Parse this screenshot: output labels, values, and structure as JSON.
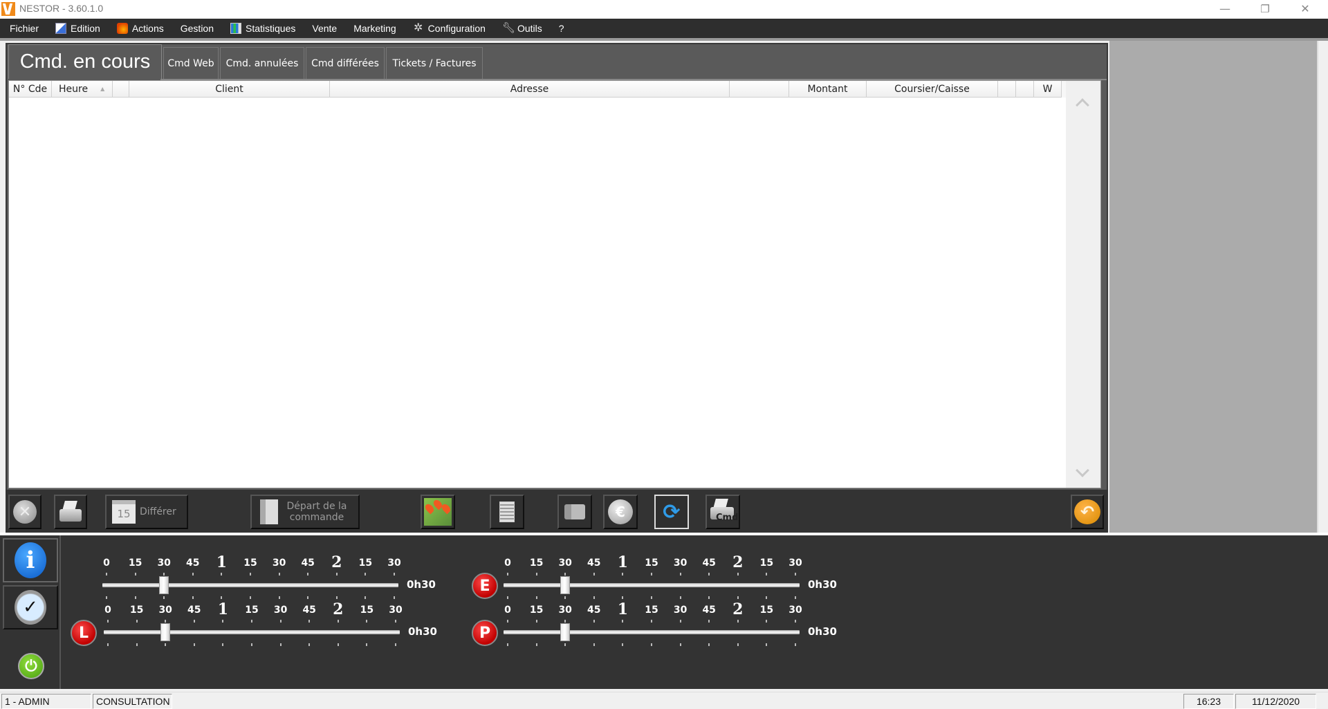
{
  "window": {
    "title": "NESTOR - 3.60.1.0",
    "minimize": "—",
    "maximize": "❐",
    "close": "✕"
  },
  "menu": [
    {
      "label": "Fichier",
      "icon": null
    },
    {
      "label": "Edition",
      "icon": "edit-icon"
    },
    {
      "label": "Actions",
      "icon": "actions-icon"
    },
    {
      "label": "Gestion",
      "icon": null
    },
    {
      "label": "Statistiques",
      "icon": "chart-icon"
    },
    {
      "label": "Vente",
      "icon": null
    },
    {
      "label": "Marketing",
      "icon": null
    },
    {
      "label": "Configuration",
      "icon": "gear-icon"
    },
    {
      "label": "Outils",
      "icon": "wrench-icon"
    },
    {
      "label": "?",
      "icon": null
    }
  ],
  "tabs": [
    {
      "label": "Cmd. en cours",
      "active": true
    },
    {
      "label": "Cmd Web",
      "active": false
    },
    {
      "label": "Cmd. annulées",
      "active": false
    },
    {
      "label": "Cmd différées",
      "active": false
    },
    {
      "label": "Tickets / Factures",
      "active": false
    }
  ],
  "table": {
    "columns": [
      "N° Cde",
      "Heure",
      "",
      "Client",
      "Adresse",
      "",
      "Montant",
      "Coursier/Caisse",
      "",
      "",
      "W"
    ],
    "sort_column": "Heure",
    "sort_direction": "ascending",
    "rows": []
  },
  "toolbar": {
    "cancel": "Annuler",
    "print": "Imprimer",
    "defer_label": "Différer",
    "defer_icon_text": "15",
    "depart_label": "Départ de la commande",
    "map": "Carte",
    "document": "Document",
    "card": "Fiche",
    "payment": "Paiement",
    "refresh": "Actualiser",
    "print_cmd_text": "Cmd",
    "back": "Retour"
  },
  "timelines": {
    "tick_labels": [
      "0",
      "15",
      "30",
      "45",
      "1",
      "15",
      "30",
      "45",
      "2",
      "15",
      "30"
    ],
    "big_ticks": [
      4,
      8
    ],
    "range_minutes": [
      0,
      150
    ],
    "sliders": [
      {
        "id": "default",
        "badge": null,
        "value_minutes": 30,
        "value_label": "0h30"
      },
      {
        "id": "livraison",
        "badge": "L",
        "value_minutes": 30,
        "value_label": "0h30"
      },
      {
        "id": "emporter",
        "badge": "E",
        "value_minutes": 30,
        "value_label": "0h30"
      },
      {
        "id": "place",
        "badge": "P",
        "value_minutes": 30,
        "value_label": "0h30"
      }
    ]
  },
  "status": {
    "user": "1 - ADMIN",
    "mode": "CONSULTATION",
    "time": "16:23",
    "date": "11/12/2020"
  }
}
